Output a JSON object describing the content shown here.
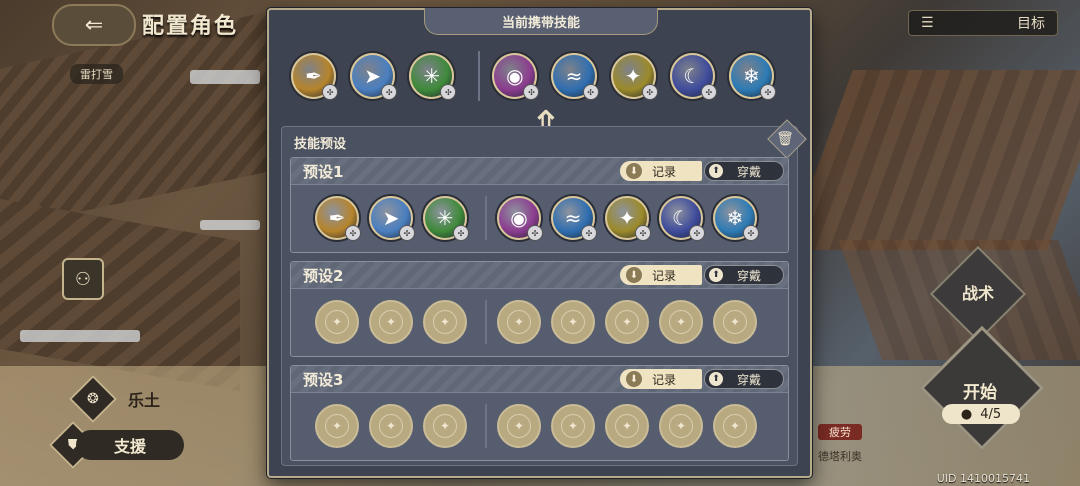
{
  "top": {
    "title": "配置角色",
    "tag": "雷打雪",
    "target": "目标"
  },
  "roles": [
    {
      "name": "乐土",
      "icon": "paw-icon"
    },
    {
      "name": "支援",
      "icon": "shield-icon"
    }
  ],
  "right": {
    "tactic": "战术",
    "start": "开始",
    "count": "4/5",
    "fatigue": "疲劳",
    "char_name": "德塔利奥"
  },
  "uid": "UID 1410015741",
  "modal": {
    "header": "当前携带技能",
    "preset_section_title": "技能预设",
    "record_label": "记录",
    "wear_label": "穿戴",
    "carried_skills": [
      {
        "icon": "golden-pen-icon",
        "color": "#b6842b",
        "glyph": "✒"
      },
      {
        "icon": "dash-icon",
        "color": "#4a7fc0",
        "glyph": "➤"
      },
      {
        "icon": "green-aura-icon",
        "color": "#3f8a3a",
        "glyph": "✳"
      },
      {
        "icon": "purple-mask-icon",
        "color": "#8c3d8f",
        "glyph": "◉"
      },
      {
        "icon": "blue-splash-icon",
        "color": "#2f6eb0",
        "glyph": "≈"
      },
      {
        "icon": "yellow-burst-icon",
        "color": "#9b8a2a",
        "glyph": "✦"
      },
      {
        "icon": "moon-figure-icon",
        "color": "#3f4c9c",
        "glyph": "☾"
      },
      {
        "icon": "blue-crystal-icon",
        "color": "#2d7bb5",
        "glyph": "❄"
      }
    ],
    "presets": [
      {
        "name": "预设1",
        "filled": true
      },
      {
        "name": "预设2",
        "filled": false
      },
      {
        "name": "预设3",
        "filled": false
      }
    ]
  }
}
